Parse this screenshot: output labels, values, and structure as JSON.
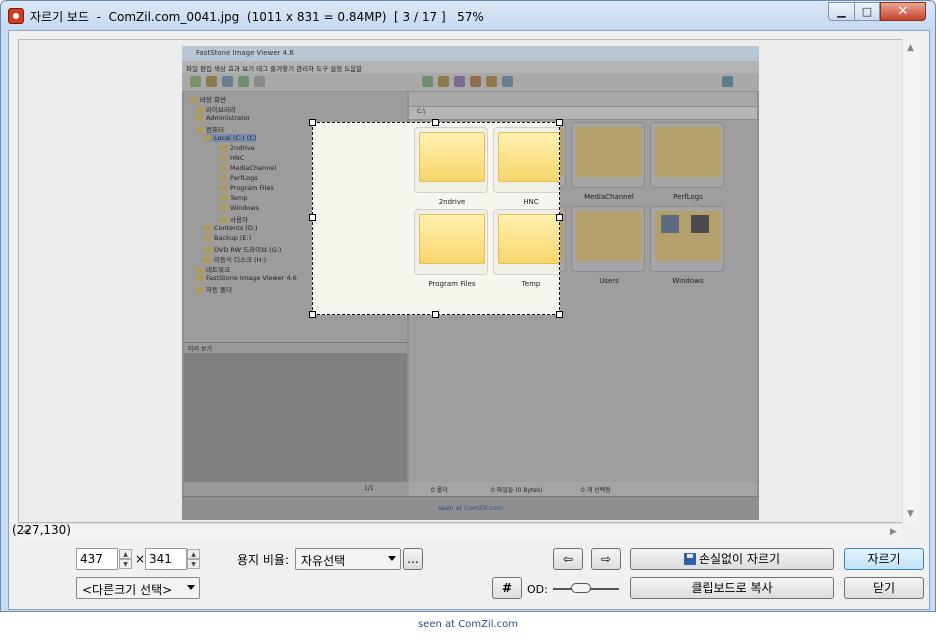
{
  "window": {
    "title": "자르기 보드  -  ComZil.com_0041.jpg  (1011 x 831 = 0.84MP)  [ 3 / 17 ]   57%",
    "minimize_glyph": "▁",
    "maximize_glyph": "□",
    "close_glyph": "✕"
  },
  "embedded_image": {
    "app_title": "FastStone Image Viewer 4.6",
    "menu": "파일   편집   색상   효과   보기   태그   즐겨찾기   관리자   도구   설정   도움말",
    "tree": [
      "바탕 화면",
      "라이브러리",
      "Administrator",
      "컴퓨터",
      "Local (C:) (C)",
      "2ndrive",
      "HNC",
      "MediaChannel",
      "PerfLogs",
      "Program Files",
      "Temp",
      "Windows",
      "사용자",
      "Contents (D:)",
      "Backup (E:)",
      "DVD RW 드라이브 (G:)",
      "이동식 디스크 (H:)",
      "네트워크",
      "FastStone Image Viewer 4.6",
      "자동 폴더"
    ],
    "preview_header": "미리 보기",
    "tree_status": "1/1",
    "address": "C:\\",
    "thumbnails": [
      "2ndrive",
      "HNC",
      "MediaChannel",
      "PerfLogs",
      "Program Files",
      "Temp",
      "Users",
      "Windows"
    ],
    "status": [
      "0 폴더",
      "0 파일들 (0 Bytes)",
      "0 개 선택됨"
    ],
    "footer": "seen at ComZil.com"
  },
  "controls": {
    "cursor_coords": "(227,130)",
    "width_value": "437",
    "times": "×",
    "height_value": "341",
    "ratio_label": "용지 비율:",
    "ratio_value": "자유선택",
    "ellipsis": "...",
    "size_select": "<다른크기 선택>",
    "arrow_left": "⇦",
    "arrow_right": "⇨",
    "lossless_crop": "손실없이 자르기",
    "crop": "자르기",
    "grid_glyph": "#",
    "od_label": "OD:",
    "copy_clipboard": "클립보드로 복사",
    "close": "닫기"
  },
  "caption": "seen at ComZil.com"
}
